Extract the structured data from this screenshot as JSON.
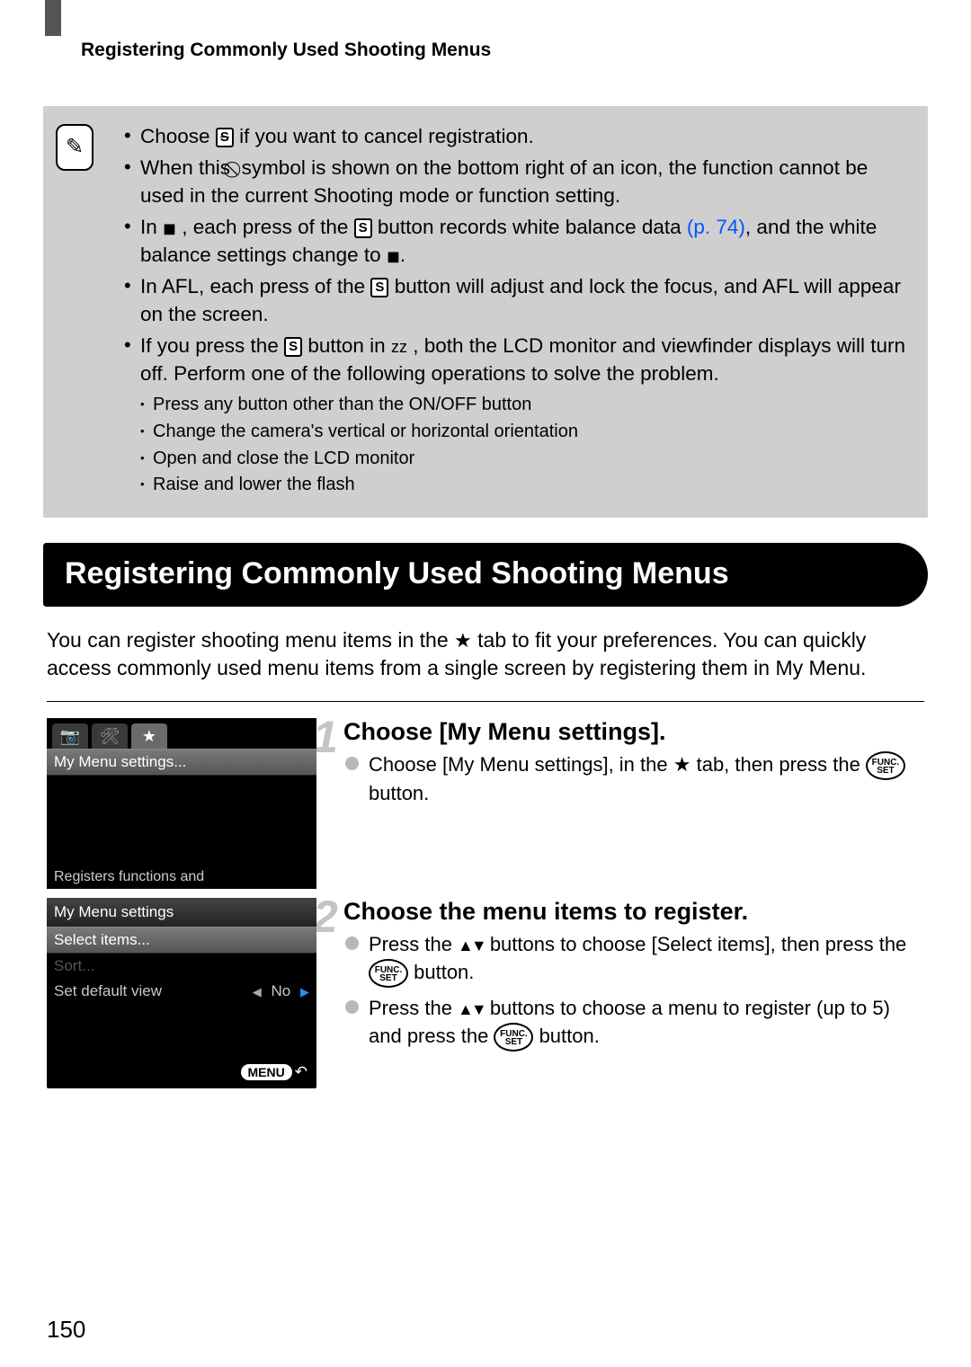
{
  "running_head": "Registering Commonly Used Shooting Menus",
  "note": {
    "b1a": "Choose ",
    "b1b": " if you want to cancel registration.",
    "b2a": "When this ",
    "b2b": " symbol is shown on the bottom right of an icon, the function cannot be used in the current Shooting mode or function setting.",
    "b3a": "In ",
    "b3b": ", each press of the ",
    "b3c": " button records white balance data ",
    "b3_link": "(p. 74)",
    "b3d": ", and the white balance settings change to ",
    "b3e": ".",
    "b4a": "In AFL, each press of the ",
    "b4b": " button will adjust and lock the focus, and AFL will appear on the screen.",
    "b5a": "If you press the ",
    "b5b": " button in ",
    "b5c": " , both the LCD monitor and viewfinder displays will turn off. Perform one of the following operations to solve the problem.",
    "sub1": "Press any button other than the ON/OFF button",
    "sub2": "Change the camera's vertical or horizontal orientation",
    "sub3": "Open and close the LCD monitor",
    "sub4": "Raise and lower the flash"
  },
  "section_title": "Registering Commonly Used Shooting Menus",
  "intro_a": "You can register shooting menu items in the ",
  "intro_b": " tab to fit your preferences. You can quickly access commonly used menu items from a single screen by registering them in My Menu.",
  "cam1": {
    "row": "My Menu settings...",
    "footer": "Registers functions and"
  },
  "cam2": {
    "title": "My Menu settings",
    "r1": "Select items...",
    "r2": "Sort...",
    "r3a": "Set default view",
    "r3b": "No",
    "menu": "MENU"
  },
  "step1": {
    "num": "1",
    "head": "Choose [My Menu settings].",
    "line_a": "Choose [My Menu settings], in the ",
    "line_b": " tab, then press the ",
    "line_c": " button."
  },
  "step2": {
    "num": "2",
    "head": "Choose the menu items to register.",
    "l1a": "Press the ",
    "l1b": " buttons to choose [Select items], then press the ",
    "l1c": " button.",
    "l2a": "Press the ",
    "l2b": " buttons to choose a menu to register (up to 5) and press the ",
    "l2c": " button."
  },
  "func_label": "FUNC.\nSET",
  "page_number": "150",
  "icons": {
    "s_button": "S",
    "cancel_s": "S",
    "prohibit": "⃠",
    "wb": "◼",
    "sleep": "zz",
    "camera": "📷",
    "tools": "🛠",
    "star": "★",
    "updown": "▲▼"
  }
}
